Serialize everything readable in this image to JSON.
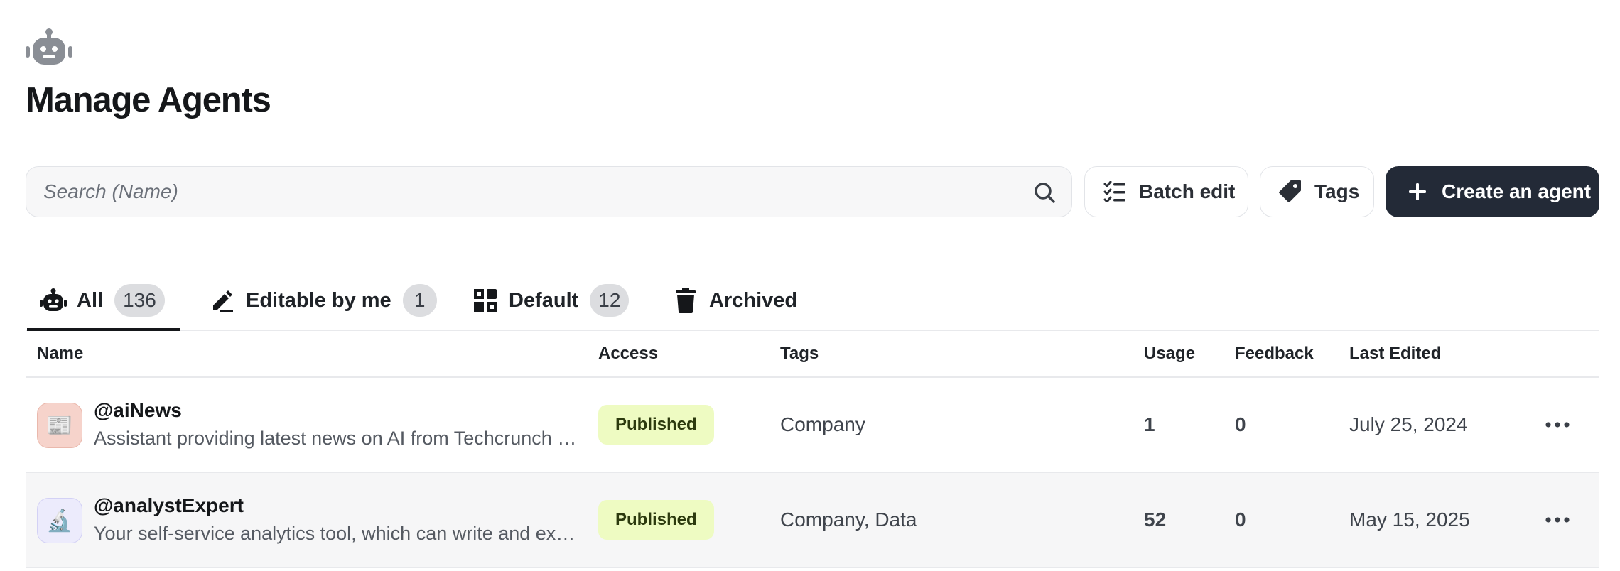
{
  "header": {
    "icon": "robot-icon",
    "title": "Manage Agents"
  },
  "toolbar": {
    "search_placeholder": "Search (Name)",
    "batch_edit_label": "Batch edit",
    "tags_label": "Tags",
    "create_label": "Create an agent"
  },
  "tabs": [
    {
      "label": "All",
      "count": "136",
      "icon": "robot-icon",
      "active": true
    },
    {
      "label": "Editable by me",
      "count": "1",
      "icon": "pencil-icon"
    },
    {
      "label": "Default",
      "count": "12",
      "icon": "puzzle-icon"
    },
    {
      "label": "Archived",
      "icon": "trash-icon"
    }
  ],
  "table": {
    "columns": {
      "name": "Name",
      "access": "Access",
      "tags": "Tags",
      "usage": "Usage",
      "feedback": "Feedback",
      "last_edited": "Last Edited"
    },
    "rows": [
      {
        "avatar": "📰",
        "avatar_bg": "#f6d3cb",
        "name": "@aiNews",
        "description": "Assistant providing latest news on AI from Techcrunch and The Verge",
        "access": "Published",
        "tags": "Company",
        "usage": "1",
        "feedback": "0",
        "last_edited": "July 25, 2024"
      },
      {
        "avatar": "🔬",
        "avatar_bg": "#ecebfc",
        "name": "@analystExpert",
        "description": "Your self-service analytics tool, which can write and execute queries",
        "access": "Published",
        "tags": "Company, Data",
        "usage": "52",
        "feedback": "0",
        "last_edited": "May 15, 2025"
      }
    ]
  },
  "colors": {
    "primary_button": "#232a37",
    "published_badge_bg": "#eefbc2",
    "count_pill_bg": "#dcdde0"
  }
}
